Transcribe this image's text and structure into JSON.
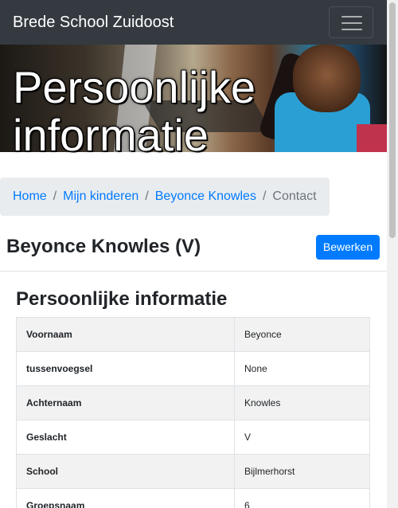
{
  "navbar": {
    "brand": "Brede School Zuidoost",
    "toggler_icon": "hamburger-menu-icon",
    "background": "#343a40"
  },
  "hero": {
    "title": "Persoonlijke informatie"
  },
  "breadcrumb": {
    "items": [
      "Home",
      "Mijn kinderen",
      "Beyonce Knowles"
    ],
    "current": "Contact",
    "separator": "/"
  },
  "card": {
    "title": "Beyonce Knowles (V)",
    "edit_label": "Bewerken",
    "accent": "#007bff"
  },
  "section": {
    "title": "Persoonlijke informatie"
  },
  "info_rows": [
    {
      "label": "Voornaam",
      "value": "Beyonce"
    },
    {
      "label": "tussenvoegsel",
      "value": "None"
    },
    {
      "label": "Achternaam",
      "value": "Knowles"
    },
    {
      "label": "Geslacht",
      "value": "V"
    },
    {
      "label": "School",
      "value": "Bijlmerhorst"
    },
    {
      "label": "Groepsnaam",
      "value": "6"
    }
  ]
}
